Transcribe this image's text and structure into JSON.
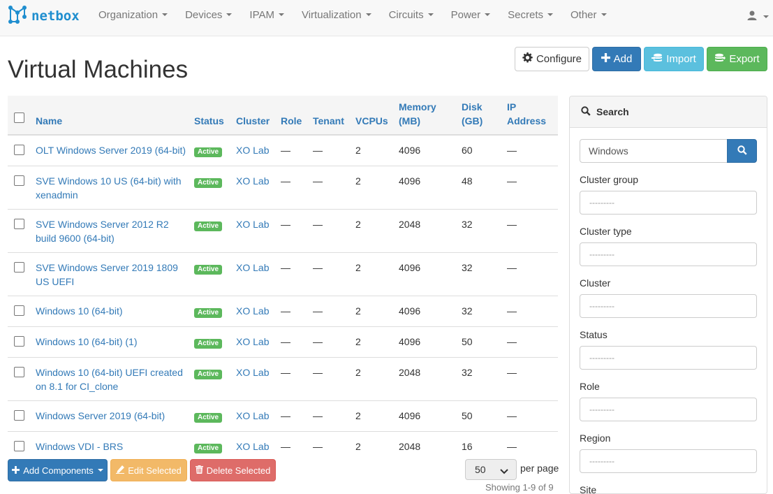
{
  "app": {
    "brand": "netbox",
    "accent": "#337ab7"
  },
  "nav": {
    "items": [
      {
        "label": "Organization"
      },
      {
        "label": "Devices"
      },
      {
        "label": "IPAM"
      },
      {
        "label": "Virtualization"
      },
      {
        "label": "Circuits"
      },
      {
        "label": "Power"
      },
      {
        "label": "Secrets"
      },
      {
        "label": "Other"
      }
    ],
    "user_icon": "user-icon"
  },
  "page": {
    "title": "Virtual Machines"
  },
  "toolbar": {
    "configure": "Configure",
    "add": "Add",
    "import": "Import",
    "export": "Export"
  },
  "table": {
    "headers": {
      "name": "Name",
      "status": "Status",
      "cluster": "Cluster",
      "role": "Role",
      "tenant": "Tenant",
      "vcpus": "VCPUs",
      "memory": "Memory (MB)",
      "disk": "Disk (GB)",
      "ip": "IP Address"
    },
    "rows": [
      {
        "name": "OLT Windows Server 2019 (64-bit)",
        "status": "Active",
        "cluster": "XO Lab",
        "role": "—",
        "tenant": "—",
        "vcpus": "2",
        "memory": "4096",
        "disk": "60",
        "ip": "—"
      },
      {
        "name": "SVE Windows 10 US (64-bit) with xenadmin",
        "status": "Active",
        "cluster": "XO Lab",
        "role": "—",
        "tenant": "—",
        "vcpus": "2",
        "memory": "4096",
        "disk": "48",
        "ip": "—"
      },
      {
        "name": "SVE Windows Server 2012 R2 build 9600 (64-bit)",
        "status": "Active",
        "cluster": "XO Lab",
        "role": "—",
        "tenant": "—",
        "vcpus": "2",
        "memory": "2048",
        "disk": "32",
        "ip": "—"
      },
      {
        "name": "SVE Windows Server 2019 1809 US UEFI",
        "status": "Active",
        "cluster": "XO Lab",
        "role": "—",
        "tenant": "—",
        "vcpus": "2",
        "memory": "4096",
        "disk": "32",
        "ip": "—"
      },
      {
        "name": "Windows 10 (64-bit)",
        "status": "Active",
        "cluster": "XO Lab",
        "role": "—",
        "tenant": "—",
        "vcpus": "2",
        "memory": "4096",
        "disk": "32",
        "ip": "—"
      },
      {
        "name": "Windows 10 (64-bit) (1)",
        "status": "Active",
        "cluster": "XO Lab",
        "role": "—",
        "tenant": "—",
        "vcpus": "2",
        "memory": "4096",
        "disk": "50",
        "ip": "—"
      },
      {
        "name": "Windows 10 (64-bit) UEFI created on 8.1 for CI_clone",
        "status": "Active",
        "cluster": "XO Lab",
        "role": "—",
        "tenant": "—",
        "vcpus": "2",
        "memory": "2048",
        "disk": "32",
        "ip": "—"
      },
      {
        "name": "Windows Server 2019 (64-bit)",
        "status": "Active",
        "cluster": "XO Lab",
        "role": "—",
        "tenant": "—",
        "vcpus": "2",
        "memory": "4096",
        "disk": "50",
        "ip": "—"
      },
      {
        "name": "Windows VDI - BRS",
        "status": "Active",
        "cluster": "XO Lab",
        "role": "—",
        "tenant": "—",
        "vcpus": "2",
        "memory": "2048",
        "disk": "16",
        "ip": "—"
      }
    ],
    "status_color": "#5cb85c"
  },
  "bulk": {
    "add_components": "Add Components",
    "edit_selected": "Edit Selected",
    "delete_selected": "Delete Selected"
  },
  "pagination": {
    "per_page_value": "50",
    "per_page_label": "per page",
    "showing": "Showing 1-9 of 9"
  },
  "search_panel": {
    "heading": "Search",
    "query": "Windows",
    "filters": [
      {
        "label": "Cluster group",
        "placeholder": "---------"
      },
      {
        "label": "Cluster type",
        "placeholder": "---------"
      },
      {
        "label": "Cluster",
        "placeholder": "---------"
      },
      {
        "label": "Status",
        "placeholder": "---------"
      },
      {
        "label": "Role",
        "placeholder": "---------"
      },
      {
        "label": "Region",
        "placeholder": "---------"
      }
    ],
    "next_label": "Site"
  }
}
